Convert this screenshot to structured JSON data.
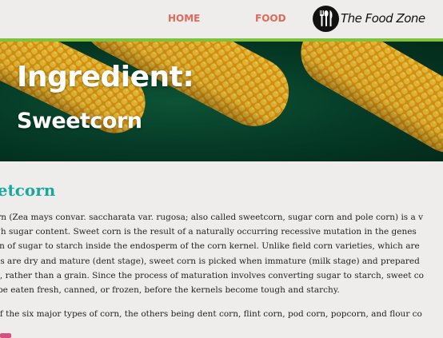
{
  "nav": {
    "home_label": "HOME",
    "food_label": "FOOD",
    "logo_text": "The Food Zone",
    "logo_icon": "fork-spoon-knife-icon",
    "accent_color": "#e06a5a",
    "bar_color": "#7ec13b"
  },
  "hero": {
    "title": "Ingredient:",
    "subtitle": "Sweetcorn"
  },
  "article": {
    "heading": "eetcorn",
    "heading_color": "#17a8a0",
    "para1_lines": [
      "corn (Zea mays convar. saccharata var. rugosa; also called sweetcorn, sugar corn and pole corn) is a v",
      "high sugar content. Sweet corn is the result of a naturally occurring recessive mutation in the genes",
      "sion of sugar to starch inside the endosperm of the corn kernel. Unlike field corn varieties, which are",
      "nels are dry and mature (dent stage), sweet corn is picked when immature (milk stage) and prepared",
      "ole, rather than a grain. Since the process of maturation involves converting sugar to starch, sweet co",
      "st be eaten fresh, canned, or frozen, before the kernels become tough and starchy."
    ],
    "para2": "e of the six major types of corn, the others being dent corn, flint corn, pod corn, popcorn, and flour co"
  }
}
